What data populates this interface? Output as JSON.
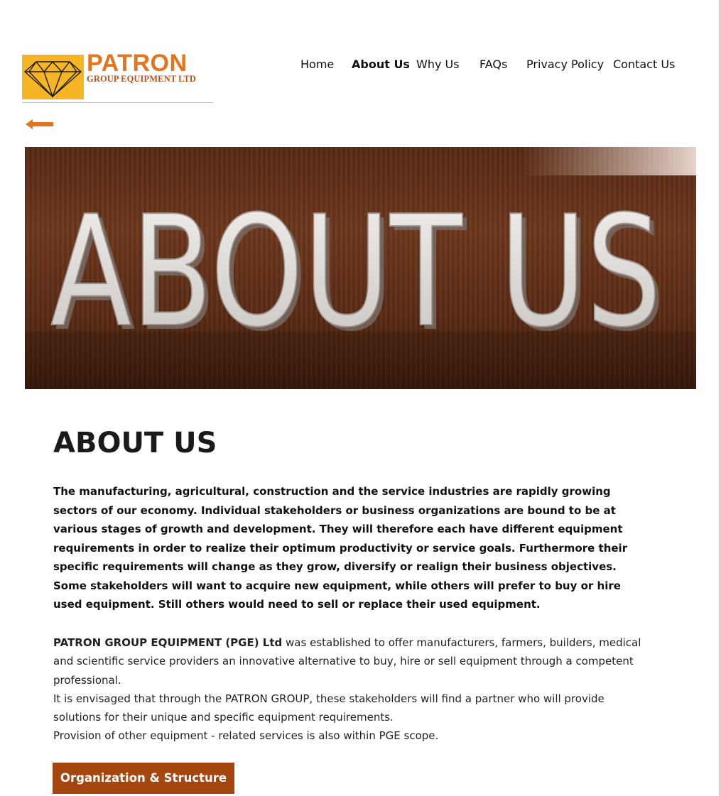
{
  "brand": {
    "name": "PATRON",
    "subtitle": "GROUP EQUIPMENT LTD"
  },
  "nav": {
    "items": [
      {
        "label": "Home",
        "active": false
      },
      {
        "label": "About Us",
        "active": true
      },
      {
        "label": "Why Us",
        "active": false
      },
      {
        "label": "FAQs",
        "active": false
      },
      {
        "label": "Privacy Policy",
        "active": false
      },
      {
        "label": "Contact Us",
        "active": false
      }
    ]
  },
  "icons": {
    "back": "arrow-left-icon",
    "logo": "diamond-icon"
  },
  "hero": {
    "text": "ABOUT US"
  },
  "content": {
    "heading": "ABOUT US",
    "intro_p1": "The manufacturing, agricultural, construction and the service industries are rapidly growing sectors of our economy. Individual stakeholders or business organizations are bound to be at various stages of growth and development. They will therefore each have different equipment requirements in order to realize their optimum productivity or service goals. Furthermore their specific requirements will change as they grow, diversify or realign their business objectives.",
    "intro_p2": "Some stakeholders will want to acquire new equipment, while others will prefer to buy or hire used equipment. Still others would need to sell or replace their used equipment.",
    "company_name": "PATRON GROUP EQUIPMENT (PGE) Ltd",
    "desc_p1_rest": " was established to offer manufacturers, farmers, builders, medical and scientific service providers an innovative alternative to buy, hire or sell equipment through a competent professional.",
    "desc_p2": "It is envisaged that through the PATRON GROUP, these stakeholders will find a partner who will provide solutions for their unique and specific equipment requirements.",
    "desc_p3": "Provision of other equipment - related services is also within PGE scope."
  },
  "cta": {
    "label": "Organization & Structure"
  },
  "colors": {
    "brand_orange": "#e4751c",
    "logo_yellow": "#f6b524",
    "button_brown": "#a5460e"
  }
}
